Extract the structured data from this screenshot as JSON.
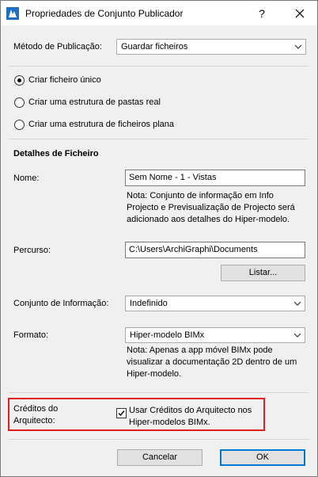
{
  "window": {
    "title": "Propriedades de Conjunto Publicador",
    "help_label": "?"
  },
  "publish_method": {
    "label": "Método de Publicação:",
    "value": "Guardar ficheiros"
  },
  "radios": [
    {
      "label": "Criar ficheiro único",
      "checked": true
    },
    {
      "label": "Criar uma estrutura de pastas real",
      "checked": false
    },
    {
      "label": "Criar uma estrutura de ficheiros plana",
      "checked": false
    }
  ],
  "file_details": {
    "heading": "Detalhes de Ficheiro",
    "name_label": "Nome:",
    "name_value": "Sem Nome - 1 - Vistas",
    "name_note": [
      "Nota: Conjunto de informação em Info",
      "Projecto e Previsualização de Projecto será",
      "adicionado aos detalhes do Hiper-modelo."
    ],
    "path_label": "Percurso:",
    "path_value": "C:\\Users\\ArchiGraphi\\Documents",
    "browse_label": "Listar...",
    "info_set_label": "Conjunto de Informação:",
    "info_set_value": "Indefinido",
    "format_label": "Formato:",
    "format_value": "Hiper-modelo BIMx",
    "format_note": [
      "Nota: Apenas a app móvel BIMx pode",
      "visualizar a documentação 2D dentro de um",
      "Hiper-modelo."
    ]
  },
  "credits": {
    "label_lines": [
      "Créditos do",
      "Arquitecto:"
    ],
    "checkbox_lines": [
      "Usar Créditos do Arquitecto nos",
      "Hiper-modelos BIMx."
    ],
    "checked": true
  },
  "footer": {
    "cancel_label": "Cancelar",
    "ok_label": "OK"
  },
  "colors": {
    "highlight": "#e02020",
    "default_button_border": "#0078d7",
    "app_icon": "#1e6fc4"
  }
}
